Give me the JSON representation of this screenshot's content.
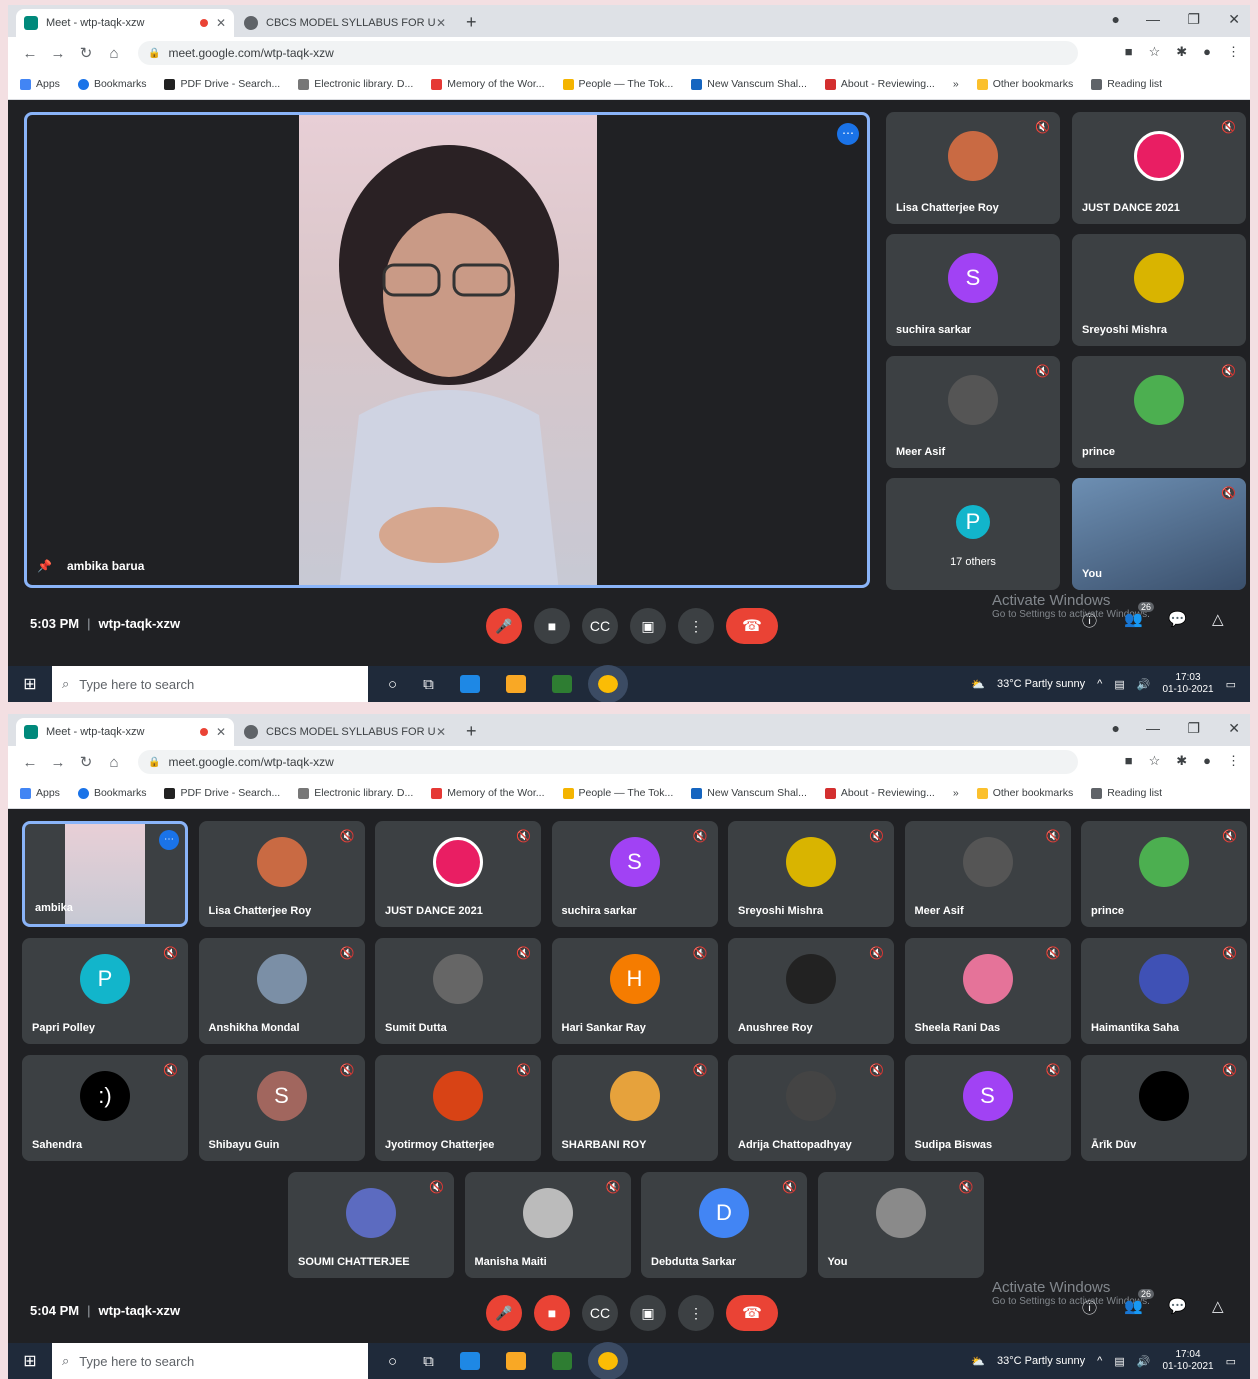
{
  "browser": {
    "tabs": [
      {
        "title": "Meet - wtp-taqk-xzw",
        "active": true
      },
      {
        "title": "CBCS MODEL SYLLABUS FOR U...",
        "active": false
      }
    ],
    "url": "meet.google.com/wtp-taqk-xzw",
    "bookmarks": [
      "Apps",
      "Bookmarks",
      "PDF Drive - Search...",
      "Electronic library. D...",
      "Memory of the Wor...",
      "People — The Tok...",
      "New Vanscum Shal...",
      "About - Reviewing...",
      "»",
      "Other bookmarks",
      "Reading list"
    ]
  },
  "screen1": {
    "presenter": "ambika barua",
    "tiles": [
      {
        "name": "Lisa Chatterjee Roy",
        "avatar": "photo",
        "color": "#c96a43"
      },
      {
        "name": "JUST DANCE 2021",
        "avatar": "logo",
        "color": "#e91e63"
      },
      {
        "name": "suchira sarkar",
        "avatar": "S",
        "color": "#a142f4"
      },
      {
        "name": "Sreyoshi Mishra",
        "avatar": "photo",
        "color": "#d9b400"
      },
      {
        "name": "Meer Asif",
        "avatar": "photo",
        "color": "#555555"
      },
      {
        "name": "prince",
        "avatar": "photo",
        "color": "#4caf50"
      },
      {
        "name": "17 others",
        "avatar": "P",
        "color": "#12b5cb"
      },
      {
        "name": "You",
        "avatar": "video",
        "color": "#3a6ea5"
      }
    ],
    "time": "5:03 PM",
    "meeting_code": "wtp-taqk-xzw",
    "people_count": "26",
    "taskbar": {
      "weather": "33°C  Partly sunny",
      "clock_time": "17:03",
      "clock_date": "01-10-2021"
    }
  },
  "screen2": {
    "tiles": [
      {
        "name": "ambika",
        "avatar": "video",
        "color": "#d9c6c9"
      },
      {
        "name": "Lisa Chatterjee Roy",
        "avatar": "photo",
        "color": "#c96a43"
      },
      {
        "name": "JUST DANCE 2021",
        "avatar": "logo",
        "color": "#e91e63"
      },
      {
        "name": "suchira sarkar",
        "avatar": "S",
        "color": "#a142f4"
      },
      {
        "name": "Sreyoshi Mishra",
        "avatar": "photo",
        "color": "#d9b400"
      },
      {
        "name": "Meer Asif",
        "avatar": "photo",
        "color": "#555555"
      },
      {
        "name": "prince",
        "avatar": "photo",
        "color": "#4caf50"
      },
      {
        "name": "Papri Polley",
        "avatar": "P",
        "color": "#12b5cb"
      },
      {
        "name": "Anshikha Mondal",
        "avatar": "photo",
        "color": "#7b8fa6"
      },
      {
        "name": "Sumit Dutta",
        "avatar": "photo",
        "color": "#666666"
      },
      {
        "name": "Hari Sankar Ray",
        "avatar": "H",
        "color": "#f57c00"
      },
      {
        "name": "Anushree Roy",
        "avatar": "photo",
        "color": "#222222"
      },
      {
        "name": "Sheela Rani Das",
        "avatar": "photo",
        "color": "#e57399"
      },
      {
        "name": "Haimantika Saha",
        "avatar": "photo",
        "color": "#3f51b5"
      },
      {
        "name": "Sahendra",
        "avatar": ":)",
        "color": "#000000"
      },
      {
        "name": "Shibayu Guin",
        "avatar": "S",
        "color": "#a1665e"
      },
      {
        "name": "Jyotirmoy Chatterjee",
        "avatar": "photo",
        "color": "#d84315"
      },
      {
        "name": "SHARBANI ROY",
        "avatar": "photo",
        "color": "#e6a23c"
      },
      {
        "name": "Adrija Chattopadhyay",
        "avatar": "photo",
        "color": "#444444"
      },
      {
        "name": "Sudipa Biswas",
        "avatar": "S",
        "color": "#a142f4"
      },
      {
        "name": "Ārīk Dūv",
        "avatar": "",
        "color": "#000000"
      },
      {
        "name": "SOUMI CHATTERJEE",
        "avatar": "photo",
        "color": "#5c6bc0"
      },
      {
        "name": "Manisha Maiti",
        "avatar": "photo",
        "color": "#bbbbbb"
      },
      {
        "name": "Debdutta Sarkar",
        "avatar": "D",
        "color": "#4285f4"
      },
      {
        "name": "You",
        "avatar": "photo",
        "color": "#8a8a8a"
      }
    ],
    "time": "5:04 PM",
    "meeting_code": "wtp-taqk-xzw",
    "people_count": "26",
    "taskbar": {
      "weather": "33°C  Partly sunny",
      "clock_time": "17:04",
      "clock_date": "01-10-2021"
    }
  },
  "common": {
    "search_placeholder": "Type here to search",
    "activate_title": "Activate Windows",
    "activate_sub": "Go to Settings to activate Windows."
  }
}
